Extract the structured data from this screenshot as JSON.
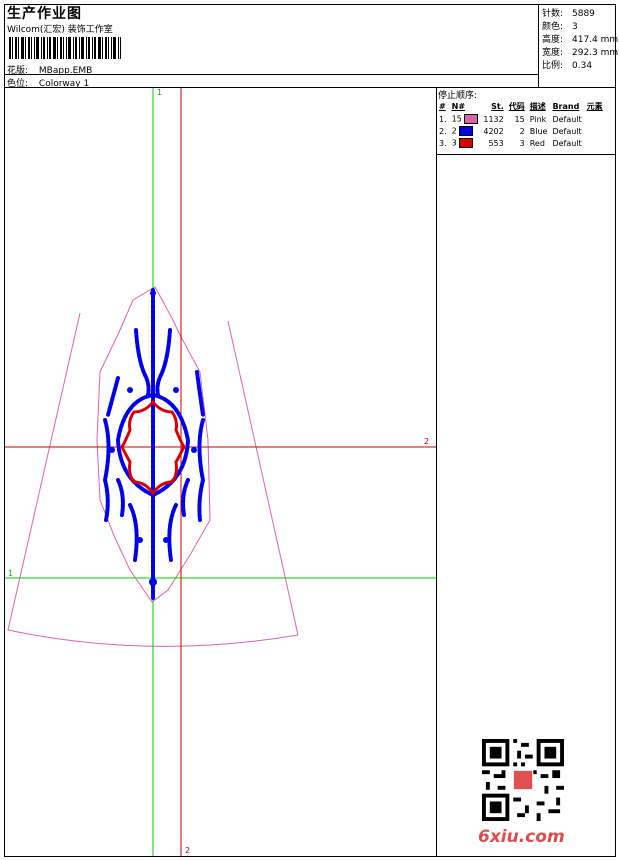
{
  "header": {
    "title": "生产作业图",
    "company": "Wilcom(汇宏) 装饰工作室",
    "design_label": "花版:",
    "design_value": "MBapp.EMB",
    "colorway_label": "色位:",
    "colorway_value": "Colorway 1"
  },
  "stats": [
    {
      "label": "针数:",
      "value": "5889"
    },
    {
      "label": "颜色:",
      "value": "3"
    },
    {
      "label": "高度:",
      "value": "417.4 mm"
    },
    {
      "label": "宽度:",
      "value": "292.3 mm"
    },
    {
      "label": "比例:",
      "value": "0.34"
    }
  ],
  "stop_sequence": {
    "title": "停止顺序:",
    "headers": [
      "#",
      "N#",
      "St.",
      "代码",
      "描述",
      "Brand",
      "元素"
    ],
    "rows": [
      {
        "idx": "1.",
        "n": "15",
        "color": "#e060b0",
        "st": "1132",
        "code": "15",
        "desc": "Pink",
        "brand": "Default",
        "element": ""
      },
      {
        "idx": "2.",
        "n": "2",
        "color": "#0000ee",
        "st": "4202",
        "code": "2",
        "desc": "Blue",
        "brand": "Default",
        "element": ""
      },
      {
        "idx": "3.",
        "n": "3",
        "color": "#dd0000",
        "st": "553",
        "code": "3",
        "desc": "Red",
        "brand": "Default",
        "element": ""
      }
    ]
  },
  "axes": {
    "green_vertical_label": "1",
    "green_horizontal_label": "1",
    "red_vertical_label": "2",
    "red_horizontal_label": "2"
  },
  "colors": {
    "pink_outline": "#e060b0",
    "blue_stitch": "#0000ee",
    "red_stitch": "#dd0000",
    "green_axis": "#00cc00",
    "red_axis": "#cc0000"
  },
  "watermark": {
    "logo_text": "6xiu.com"
  }
}
